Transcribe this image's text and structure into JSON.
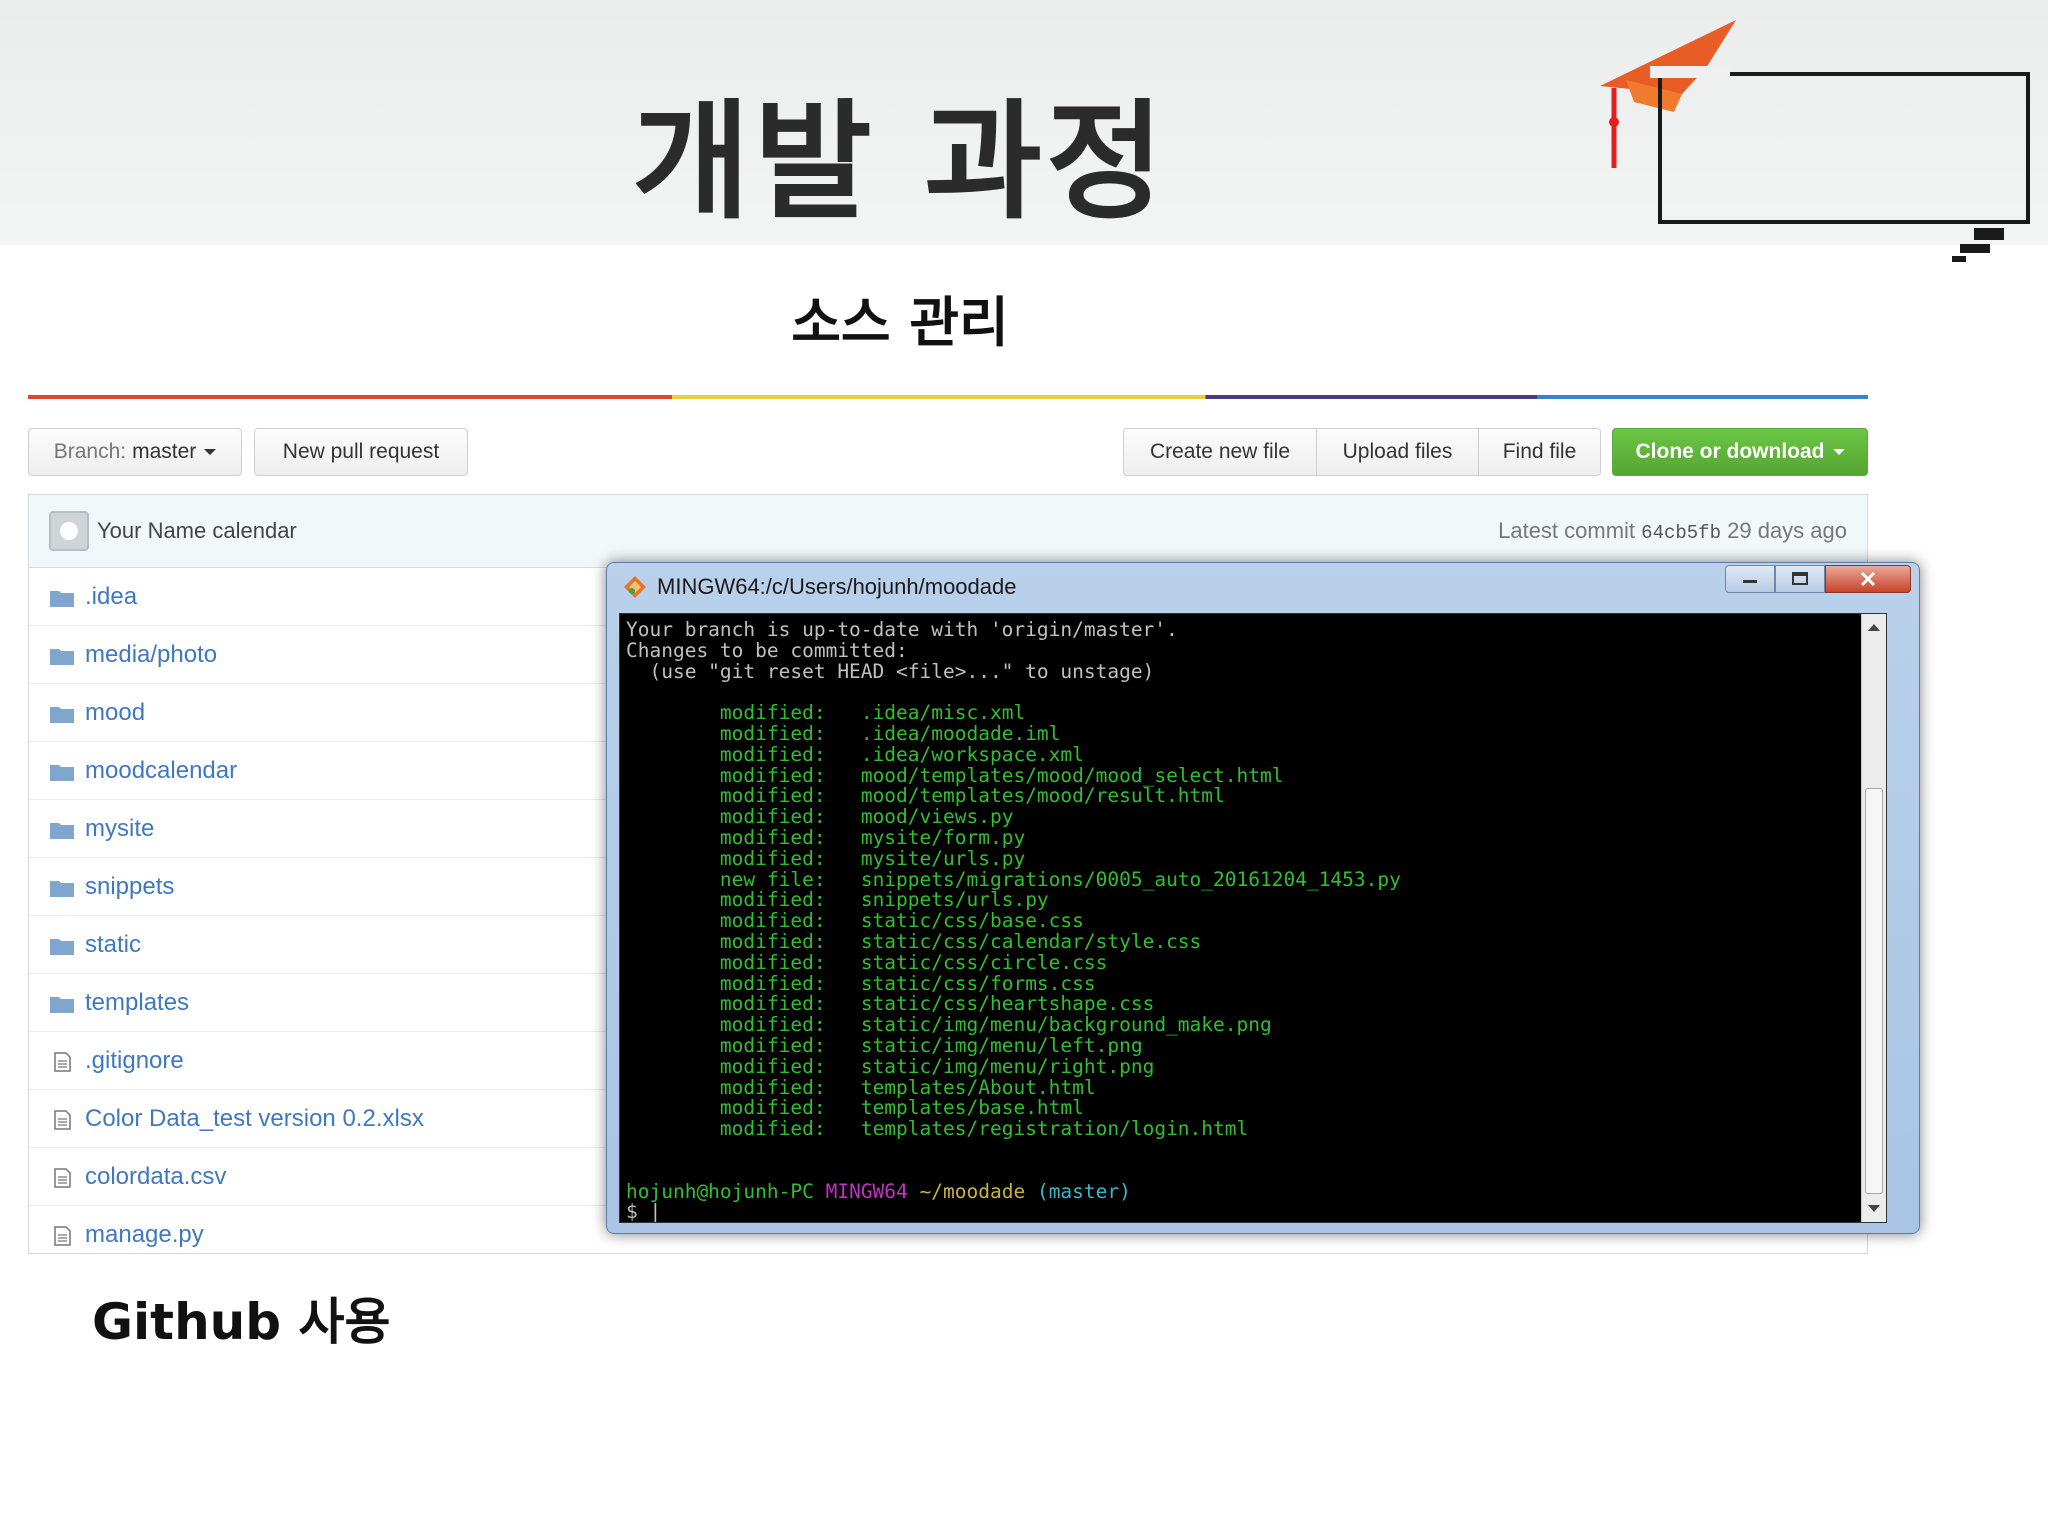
{
  "slide": {
    "title": "개발 과정",
    "section": "소스 관리",
    "footer": "Github 사용"
  },
  "toolbar": {
    "branch_prefix": "Branch:",
    "branch_name": "master",
    "new_pull_request": "New pull request",
    "create_new_file": "Create new file",
    "upload_files": "Upload files",
    "find_file": "Find file",
    "clone_or_download": "Clone or download"
  },
  "commit": {
    "author_message": "Your Name calendar",
    "latest_label": "Latest commit",
    "sha": "64cb5fb",
    "age": "29 days ago"
  },
  "files": [
    {
      "name": ".idea",
      "type": "folder"
    },
    {
      "name": "media/photo",
      "type": "folder"
    },
    {
      "name": "mood",
      "type": "folder"
    },
    {
      "name": "moodcalendar",
      "type": "folder"
    },
    {
      "name": "mysite",
      "type": "folder"
    },
    {
      "name": "snippets",
      "type": "folder"
    },
    {
      "name": "static",
      "type": "folder"
    },
    {
      "name": "templates",
      "type": "folder"
    },
    {
      "name": ".gitignore",
      "type": "file"
    },
    {
      "name": "Color Data_test version 0.2.xlsx",
      "type": "file"
    },
    {
      "name": "colordata.csv",
      "type": "file"
    },
    {
      "name": "manage.py",
      "type": "file"
    }
  ],
  "terminal": {
    "title": "MINGW64:/c/Users/hojunh/moodade",
    "header_lines": [
      "Your branch is up-to-date with 'origin/master'.",
      "Changes to be committed:",
      "  (use \"git reset HEAD <file>...\" to unstage)"
    ],
    "changes": [
      {
        "status": "modified:",
        "path": ".idea/misc.xml"
      },
      {
        "status": "modified:",
        "path": ".idea/moodade.iml"
      },
      {
        "status": "modified:",
        "path": ".idea/workspace.xml"
      },
      {
        "status": "modified:",
        "path": "mood/templates/mood/mood_select.html"
      },
      {
        "status": "modified:",
        "path": "mood/templates/mood/result.html"
      },
      {
        "status": "modified:",
        "path": "mood/views.py"
      },
      {
        "status": "modified:",
        "path": "mysite/form.py"
      },
      {
        "status": "modified:",
        "path": "mysite/urls.py"
      },
      {
        "status": "new file:",
        "path": "snippets/migrations/0005_auto_20161204_1453.py"
      },
      {
        "status": "modified:",
        "path": "snippets/urls.py"
      },
      {
        "status": "modified:",
        "path": "static/css/base.css"
      },
      {
        "status": "modified:",
        "path": "static/css/calendar/style.css"
      },
      {
        "status": "modified:",
        "path": "static/css/circle.css"
      },
      {
        "status": "modified:",
        "path": "static/css/forms.css"
      },
      {
        "status": "modified:",
        "path": "static/css/heartshape.css"
      },
      {
        "status": "modified:",
        "path": "static/img/menu/background_make.png"
      },
      {
        "status": "modified:",
        "path": "static/img/menu/left.png"
      },
      {
        "status": "modified:",
        "path": "static/img/menu/right.png"
      },
      {
        "status": "modified:",
        "path": "templates/About.html"
      },
      {
        "status": "modified:",
        "path": "templates/base.html"
      },
      {
        "status": "modified:",
        "path": "templates/registration/login.html"
      }
    ],
    "prompt": {
      "user_host": "hojunh@hojunh-PC",
      "env": "MINGW64",
      "cwd": "~/moodade",
      "branch": "(master)",
      "symbol": "$"
    }
  },
  "colors": {
    "accent_green": "#55a532",
    "link_blue": "#4078c0",
    "terminal_green": "#2fbf2f"
  }
}
